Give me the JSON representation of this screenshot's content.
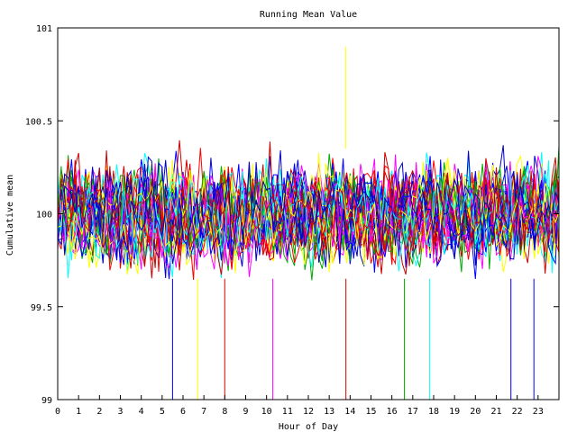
{
  "chart_data": {
    "type": "line",
    "title": "Running Mean Value",
    "xlabel": "Hour of Day",
    "ylabel": "Cumulative mean",
    "xlim": [
      0,
      24
    ],
    "ylim": [
      99,
      101
    ],
    "x_ticks": [
      "0",
      "1",
      "2",
      "3",
      "4",
      "5",
      "6",
      "7",
      "8",
      "9",
      "10",
      "11",
      "12",
      "13",
      "14",
      "15",
      "16",
      "17",
      "18",
      "19",
      "20",
      "21",
      "22",
      "23"
    ],
    "y_ticks": [
      {
        "value": 99,
        "label": "99"
      },
      {
        "value": 99.5,
        "label": "99.5"
      },
      {
        "value": 100,
        "label": "100"
      },
      {
        "value": 100.5,
        "label": "100.5"
      },
      {
        "value": 101,
        "label": "101"
      }
    ],
    "grid": false,
    "legend": "none",
    "series_colors": [
      "#ff0000",
      "#00aa00",
      "#0000ff",
      "#ff00ff",
      "#00ffff",
      "#ffff00",
      "#cc0000",
      "#0000cc"
    ],
    "series_count": 40,
    "value_center": 100,
    "value_spread": 0.45,
    "spikes": [
      {
        "x": 5.5,
        "y": 99
      },
      {
        "x": 6.7,
        "y": 99
      },
      {
        "x": 8.0,
        "y": 99
      },
      {
        "x": 10.3,
        "y": 99
      },
      {
        "x": 13.8,
        "y": 99
      },
      {
        "x": 16.6,
        "y": 99
      },
      {
        "x": 17.8,
        "y": 99
      },
      {
        "x": 21.7,
        "y": 99
      },
      {
        "x": 22.8,
        "y": 99
      },
      {
        "x": 13.8,
        "y": 100.9
      }
    ]
  }
}
